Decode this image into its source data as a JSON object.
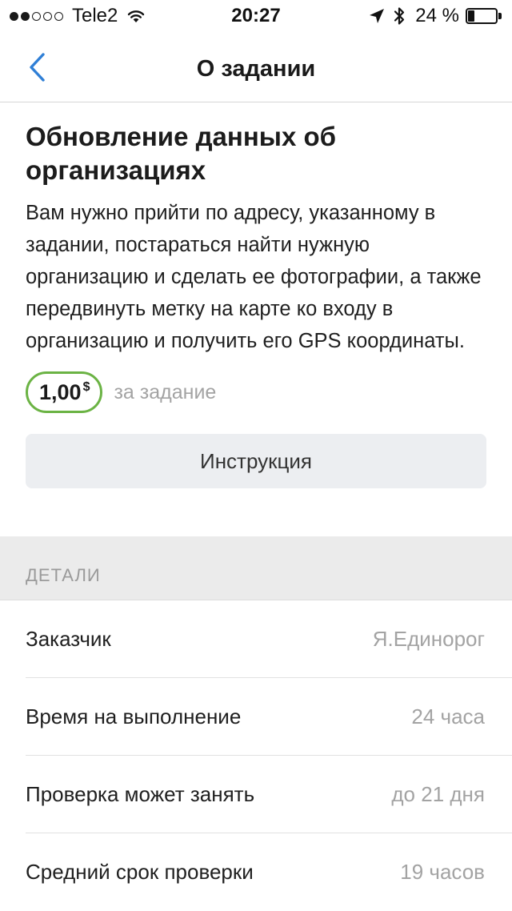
{
  "status_bar": {
    "signal_bars_filled": 2,
    "signal_bars_total": 5,
    "carrier": "Tele2",
    "time": "20:27",
    "battery_text": "24 %",
    "battery_level": 0.24,
    "icons": [
      "wifi-icon",
      "location-arrow-icon",
      "bluetooth-icon",
      "battery-icon"
    ]
  },
  "nav": {
    "back_icon": "chevron-left-icon",
    "title": "О задании",
    "accent_color": "#2f7fd6"
  },
  "task": {
    "title": "Обновление данных об организациях",
    "description": "Вам нужно прийти по адресу, указанному в задании, постараться найти нужную организацию и сделать ее фотографии, а также передвинуть метку на карте ко входу в организацию и получить его GPS координаты.",
    "price": {
      "amount": "1,00",
      "currency": "$",
      "caption": "за задание",
      "border_color": "#6bb344"
    },
    "instruction_button": "Инструкция"
  },
  "details": {
    "header": "ДЕТАЛИ",
    "rows": [
      {
        "label": "Заказчик",
        "value": "Я.Единорог"
      },
      {
        "label": "Время на выполнение",
        "value": "24 часа"
      },
      {
        "label": "Проверка может занять",
        "value": "до 21 дня"
      },
      {
        "label": "Средний срок проверки",
        "value": "19 часов"
      }
    ]
  }
}
